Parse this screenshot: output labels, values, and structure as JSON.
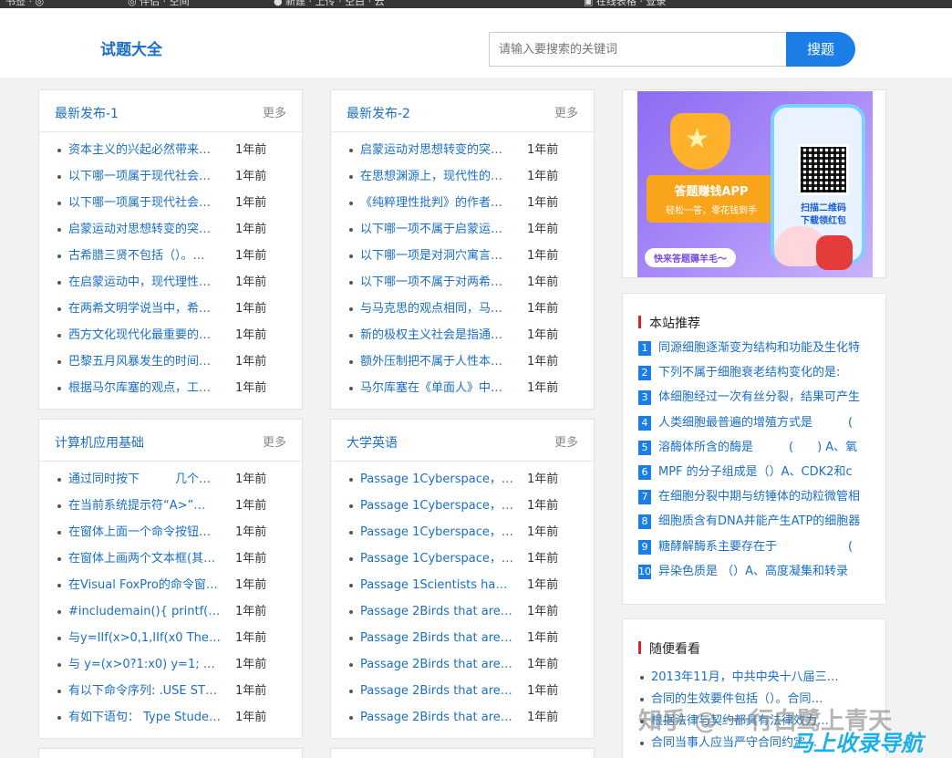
{
  "browser_strip": [
    "书签 · ◎",
    "◎ 伴侣 · 空间",
    "● 新建 · 上传 · 空白 · 云",
    "▣ 在线表格 · 登录"
  ],
  "header": {
    "logo": "试题大全",
    "search_placeholder": "请输入要搜索的关键词",
    "search_button": "搜题"
  },
  "panels": [
    {
      "title": "最新发布-1",
      "more": "更多",
      "items": [
        {
          "t": "资本主义的兴起必然带来…",
          "d": "1年前"
        },
        {
          "t": "以下哪一项属于现代社会…",
          "d": "1年前"
        },
        {
          "t": "以下哪一项属于现代社会…",
          "d": "1年前"
        },
        {
          "t": "启蒙运动对思想转变的突…",
          "d": "1年前"
        },
        {
          "t": "古希腊三贤不包括（）。…",
          "d": "1年前"
        },
        {
          "t": "在启蒙运动中，现代理性…",
          "d": "1年前"
        },
        {
          "t": "在两希文明学说当中，希…",
          "d": "1年前"
        },
        {
          "t": "西方文化现代化最重要的…",
          "d": "1年前"
        },
        {
          "t": "巴黎五月风暴发生的时间…",
          "d": "1年前"
        },
        {
          "t": "根据马尔库塞的观点，工…",
          "d": "1年前"
        }
      ]
    },
    {
      "title": "最新发布-2",
      "more": "更多",
      "items": [
        {
          "t": "启蒙运动对思想转变的突…",
          "d": "1年前"
        },
        {
          "t": "在思想渊源上，现代性的…",
          "d": "1年前"
        },
        {
          "t": "《纯粹理性批判》的作者…",
          "d": "1年前"
        },
        {
          "t": "以下哪一项不属于启蒙运…",
          "d": "1年前"
        },
        {
          "t": "以下哪一项是对洞穴寓言…",
          "d": "1年前"
        },
        {
          "t": "以下哪一项不属于对两希…",
          "d": "1年前"
        },
        {
          "t": "与马克思的观点相同，马…",
          "d": "1年前"
        },
        {
          "t": "新的极权主义社会是指通…",
          "d": "1年前"
        },
        {
          "t": "额外压制把不属于人性本…",
          "d": "1年前"
        },
        {
          "t": "马尔库塞在《单面人》中…",
          "d": "1年前"
        }
      ]
    },
    {
      "title": "计算机应用基础",
      "more": "更多",
      "items": [
        {
          "t": "通过同时按下　　　几个…",
          "d": "1年前"
        },
        {
          "t": "在当前系统提示符“A>”…",
          "d": "1年前"
        },
        {
          "t": "在窗体上面一个命令按钮…",
          "d": "1年前"
        },
        {
          "t": "在窗体上画两个文本框(其…",
          "d": "1年前"
        },
        {
          "t": "在Visual FoxPro的命令窗…",
          "d": "1年前"
        },
        {
          "t": "#includemain(){ printf(\"\\…",
          "d": "1年前"
        },
        {
          "t": "与y=IIf(x>0,1,IIf(x0 Then…",
          "d": "1年前"
        },
        {
          "t": "与 y=(x>0?1:x0) y=1; B) i…",
          "d": "1年前"
        },
        {
          "t": "有以下命令序列: .USE STU…",
          "d": "1年前"
        },
        {
          "t": "有如下语句： Type Stude…",
          "d": "1年前"
        }
      ]
    },
    {
      "title": "大学英语",
      "more": "更多",
      "items": [
        {
          "t": "Passage 1Cyberspace，d…",
          "d": "1年前"
        },
        {
          "t": "Passage 1Cyberspace，d…",
          "d": "1年前"
        },
        {
          "t": "Passage 1Cyberspace，d…",
          "d": "1年前"
        },
        {
          "t": "Passage 1Cyberspace，d…",
          "d": "1年前"
        },
        {
          "t": "Passage 1Scientists have…",
          "d": "1年前"
        },
        {
          "t": "Passage 2Birds that are li…",
          "d": "1年前"
        },
        {
          "t": "Passage 2Birds that are li…",
          "d": "1年前"
        },
        {
          "t": "Passage 2Birds that are li…",
          "d": "1年前"
        },
        {
          "t": "Passage 2Birds that are li…",
          "d": "1年前"
        },
        {
          "t": "Passage 2Birds that are li…",
          "d": "1年前"
        }
      ]
    }
  ],
  "ad": {
    "app_main": "答题赚钱APP",
    "app_sub": "轻松一答，零花钱到手",
    "scan_line1": "扫描二维码",
    "scan_line2": "下载领红包",
    "tag": "快来答题薅羊毛～"
  },
  "recommend": {
    "title": "本站推荐",
    "items": [
      {
        "n": "1",
        "t": "同源细胞逐渐变为结构和功能及生化特"
      },
      {
        "n": "2",
        "t": "下列不属于细胞衰老结构变化的是:"
      },
      {
        "n": "3",
        "t": "体细胞经过一次有丝分裂，结果可产生"
      },
      {
        "n": "4",
        "t": "人类细胞最普遍的增殖方式是　　　("
      },
      {
        "n": "5",
        "t": "溶酶体所含的酶是　　　(　　) A、氧"
      },
      {
        "n": "6",
        "t": "MPF 的分子组成是（）A、CDK2和c"
      },
      {
        "n": "7",
        "t": "在细胞分裂中期与纺锤体的动粒微管相"
      },
      {
        "n": "8",
        "t": "细胞质含有DNA并能产生ATP的细胞器"
      },
      {
        "n": "9",
        "t": "糖酵解酶系主要存在于　　　　　　(　"
      },
      {
        "n": "10",
        "t": "异染色质是 （）A、高度凝集和转录"
      }
    ]
  },
  "random": {
    "title": "随便看看",
    "items": [
      {
        "t": "2013年11月，中共中央十八届三…"
      },
      {
        "t": "合同的生效要件包括（）。合同…"
      },
      {
        "t": "根据法律与契约都具有法律效力…"
      },
      {
        "t": "合同当事人应当严守合同约定…"
      }
    ]
  },
  "watermark": {
    "text": "知乎 @ 一行白鹭上青天",
    "brand": "马上收录导航"
  },
  "colors": {
    "link": "#1a6fc4",
    "button": "#1a7ee6",
    "accent_bar": "#d9232d"
  }
}
